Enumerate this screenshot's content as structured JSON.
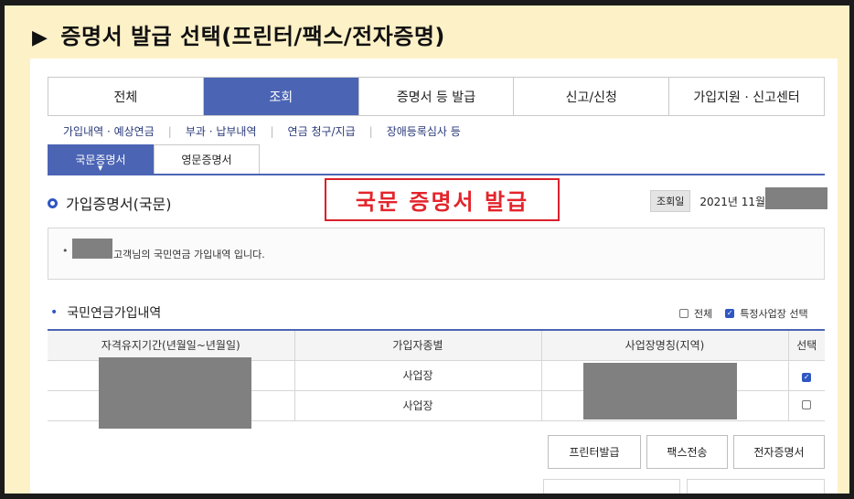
{
  "banner": {
    "title": "증명서 발급 선택(프린터/팩스/전자증명)"
  },
  "main_tabs": [
    {
      "label": "전체"
    },
    {
      "label": "조회",
      "active": true
    },
    {
      "label": "증명서 등 발급"
    },
    {
      "label": "신고/신청"
    },
    {
      "label": "가입지원 · 신고센터"
    }
  ],
  "sub_nav": [
    {
      "label": "가입내역 · 예상연금"
    },
    {
      "label": "부과 · 납부내역"
    },
    {
      "label": "연금 청구/지급"
    },
    {
      "label": "장애등록심사 등"
    }
  ],
  "cert_tabs": [
    {
      "label": "국문증명서",
      "active": true
    },
    {
      "label": "영문증명서"
    }
  ],
  "section": {
    "title": "가입증명서(국문)",
    "annotation": "국문 증명서 발급",
    "lookup_label": "조회일",
    "lookup_date": "2021년 11월"
  },
  "info": {
    "bullet": "•",
    "text": "고객님의 국민연금 가입내역 입니다."
  },
  "list": {
    "title": "국민연금가입내역",
    "filter_all": "전체",
    "filter_all_checked": false,
    "filter_select": "특정사업장 선택",
    "filter_select_checked": true
  },
  "table": {
    "headers": [
      "자격유지기간(년월일~년월일)",
      "가입자종별",
      "사업장명칭(지역)",
      "선택"
    ],
    "rows": [
      {
        "period": "",
        "type": "사업장",
        "workplace": "",
        "selected": true
      },
      {
        "period": "",
        "type": "사업장",
        "workplace": "",
        "selected": false
      }
    ]
  },
  "buttons": {
    "printer": "프린터발급",
    "fax": "팩스전송",
    "electronic": "전자증명서"
  },
  "colors": {
    "accent": "#4b64b4",
    "annotation": "#e3242b",
    "banner_bg": "#fdf1c7"
  }
}
